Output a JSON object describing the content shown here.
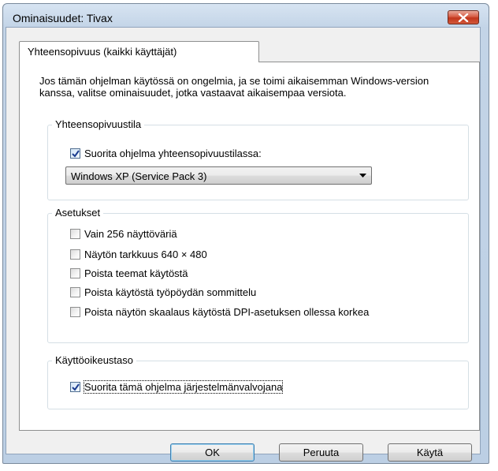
{
  "window": {
    "title": "Ominaisuudet: Tivax"
  },
  "tabs": [
    {
      "label": "Yhteensopivuus (kaikki käyttäjät)",
      "active": true
    }
  ],
  "description": "Jos tämän ohjelman käytössä on ongelmia, ja se toimi aikaisemman Windows-version kanssa, valitse ominaisuudet, jotka vastaavat aikaisempaa versiota.",
  "compat_group": {
    "label": "Yhteensopivuustila",
    "checkbox": {
      "label": "Suorita ohjelma yhteensopivuustilassa:",
      "checked": true
    },
    "select": {
      "value": "Windows XP (Service Pack 3)"
    }
  },
  "settings_group": {
    "label": "Asetukset",
    "options": [
      {
        "label": "Vain 256 näyttöväriä",
        "checked": false
      },
      {
        "label": "Näytön tarkkuus 640 × 480",
        "checked": false
      },
      {
        "label": "Poista teemat käytöstä",
        "checked": false
      },
      {
        "label": "Poista käytöstä työpöydän sommittelu",
        "checked": false
      },
      {
        "label": "Poista näytön skaalaus käytöstä DPI-asetuksen ollessa korkea",
        "checked": false
      }
    ]
  },
  "privilege_group": {
    "label": "Käyttöoikeustaso",
    "checkbox": {
      "label": "Suorita tämä ohjelma järjestelmänvalvojana",
      "checked": true
    }
  },
  "buttons": {
    "ok": "OK",
    "cancel": "Peruuta",
    "apply": "Käytä"
  },
  "colors": {
    "titlebar": "#c3d4e7",
    "close_button": "#c1361c",
    "checkmark": "#1a3c8f"
  }
}
